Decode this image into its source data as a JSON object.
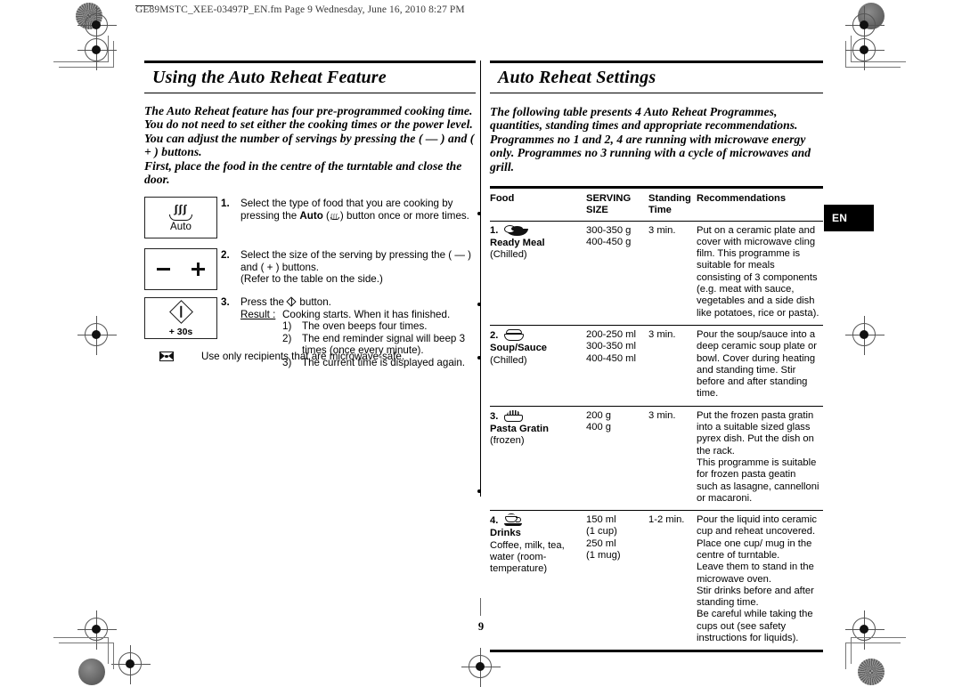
{
  "page": {
    "slug": "GE89MSTC_XEE-03497P_EN.fm  Page 9  Wednesday, June 16, 2010  8:27 PM",
    "page_number": "9",
    "language_tab": "EN"
  },
  "left_column": {
    "title": "Using the Auto Reheat Feature",
    "intro": "The Auto Reheat feature has four pre-programmed cooking time. You do not need to set either the cooking times or the power level. You can adjust the number of servings by pressing the ( — ) and ( + ) buttons.",
    "intro_line2": "First, place the food in the centre of the turntable and close the door.",
    "buttons": {
      "auto": {
        "icon": "steam-bowl-icon",
        "steam_glyph": "ʃʃʃ",
        "label": "Auto"
      },
      "minus_plus": {
        "minus_icon": "minus-icon",
        "plus_icon": "plus-icon"
      },
      "start": {
        "icon": "start-diamond-icon",
        "label": "+ 30s"
      }
    },
    "steps": [
      {
        "num": "1.",
        "text_before": "Select the type of food that you are cooking by pressing the ",
        "bold_word": "Auto",
        "text_paren_open": "(",
        "inline_icon": "auto-steam-icon",
        "text_paren_close": ")",
        "text_after": " button once or more times."
      },
      {
        "num": "2.",
        "text": "Select the size of the serving by pressing the ( — ) and ( + ) buttons.",
        "text_line2": "(Refer to the table on the side.)"
      },
      {
        "num": "3.",
        "text_before": "Press the ",
        "inline_icon": "start-diamond-icon",
        "text_after": " button.",
        "result_label": "Result :",
        "result_text": "Cooking starts. When it has finished.",
        "result_items": [
          {
            "num": "1)",
            "text": "The oven beeps four times."
          },
          {
            "num": "2)",
            "text": "The end reminder signal will beep 3 times (once every minute)."
          },
          {
            "num": "3)",
            "text": "The current time is displayed again."
          }
        ]
      }
    ],
    "note": {
      "icon": "microwave-safe-icon",
      "text": "Use only recipients that are microwave-safe."
    }
  },
  "right_column": {
    "title": "Auto  Reheat Settings",
    "intro": "The following table presents 4  Auto Reheat  Programmes, quantities, standing times and appropriate recommendations. Programmes no 1 and  2, 4 are running with microwave energy only. Programmes no 3 running with a cycle of microwaves and grill.",
    "table": {
      "headers": {
        "food": "Food",
        "serving_size_line1": "SERVING",
        "serving_size_line2": "SIZE",
        "standing_line1": "Standing",
        "standing_line2": "Time",
        "recommendations": "Recommendations"
      },
      "rows": [
        {
          "num": "1.",
          "icon": "ready-meal-plate-icon",
          "name": "Ready Meal",
          "sub": "(Chilled)",
          "serving_size": "300-350 g\n400-450 g",
          "standing_time": "3 min.",
          "recommendation": "Put on a ceramic plate and cover with microwave cling film. This programme is suitable for meals consisting of 3 components (e.g. meat with sauce, vegetables and a side dish like potatoes, rice or pasta)."
        },
        {
          "num": "2.",
          "icon": "covered-bowl-icon",
          "name": "Soup/Sauce",
          "sub": "(Chilled)",
          "serving_size": "200-250 ml\n300-350 ml\n400-450 ml",
          "standing_time": "3 min.",
          "recommendation": "Pour the soup/sauce into a deep ceramic soup plate or bowl. Cover during heating and standing time. Stir before and after standing time."
        },
        {
          "num": "3.",
          "icon": "gratin-dish-icon",
          "name": "Pasta Gratin",
          "sub": "(frozen)",
          "serving_size": "200 g\n400 g",
          "standing_time": "3 min.",
          "recommendation": "Put the frozen pasta gratin into a suitable sized glass pyrex dish. Put the dish on the rack.\nThis programme is suitable for frozen pasta geatin such as lasagne, cannelloni or macaroni."
        },
        {
          "num": "4.",
          "icon": "cup-saucer-icon",
          "name": "Drinks",
          "sub": "Coffee, milk, tea, water (room-temperature)",
          "serving_size": "150 ml\n(1 cup)\n250 ml\n(1 mug)",
          "standing_time": "1-2 min.",
          "recommendation": "Pour the liquid into ceramic cup and reheat uncovered. Place one cup/ mug in the centre of turntable.\nLeave them to stand in the microwave oven.\nStir drinks before and after standing time.\nBe careful while taking the cups out (see safety instructions for liquids)."
        }
      ]
    }
  },
  "colors": {
    "text": "#000000",
    "tab_background": "#000000",
    "tab_text": "#ffffff",
    "slug_text": "#3a3a3a"
  }
}
